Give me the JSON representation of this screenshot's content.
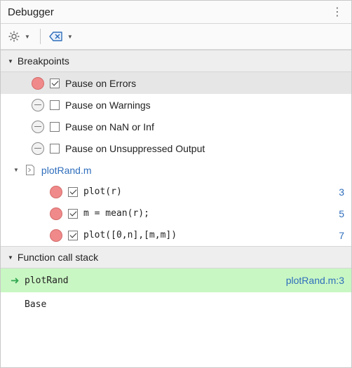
{
  "panel": {
    "title": "Debugger",
    "menu_icon": "kebab-icon"
  },
  "toolbar": {
    "settings_icon": "gear-icon",
    "clear_icon": "clear-breakpoints-icon"
  },
  "breakpoints": {
    "header": "Breakpoints",
    "global": [
      {
        "label": "Pause on Errors",
        "enabled": true,
        "checked": true,
        "selected": true
      },
      {
        "label": "Pause on Warnings",
        "enabled": false,
        "checked": false
      },
      {
        "label": "Pause on NaN or Inf",
        "enabled": false,
        "checked": false
      },
      {
        "label": "Pause on Unsuppressed Output",
        "enabled": false,
        "checked": false
      }
    ],
    "file": {
      "name": "plotRand.m",
      "lines": [
        {
          "code": "plot(r)",
          "line": "3"
        },
        {
          "code": "m = mean(r);",
          "line": "5"
        },
        {
          "code": "plot([0,n],[m,m])",
          "line": "7"
        }
      ]
    }
  },
  "call_stack": {
    "header": "Function call stack",
    "frames": [
      {
        "name": "plotRand",
        "location": "plotRand.m:3",
        "current": true
      },
      {
        "name": "Base",
        "location": "",
        "current": false
      }
    ]
  },
  "colors": {
    "breakpoint_red": "#f08a8a",
    "link_blue": "#2f6ebc",
    "current_frame_green": "#c9f7c3"
  }
}
